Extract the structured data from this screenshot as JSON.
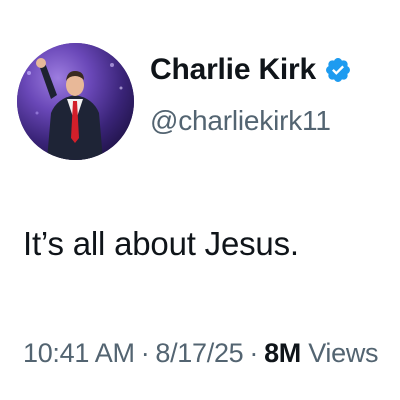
{
  "profile": {
    "display_name": "Charlie Kirk",
    "handle": "@charliekirk11",
    "verified": true,
    "verified_badge_color": "#1d9bf0"
  },
  "tweet": {
    "text": "It’s all about Jesus."
  },
  "meta": {
    "time": "10:41 AM",
    "date": "8/17/25",
    "separator": "·",
    "views_count": "8M",
    "views_label": "Views"
  },
  "colors": {
    "text_primary": "#0f1419",
    "text_secondary": "#536471",
    "avatar_background": "#4a2f8c"
  }
}
